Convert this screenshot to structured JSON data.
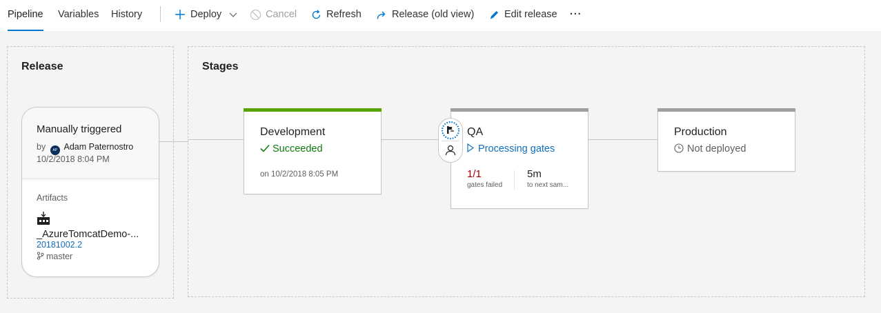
{
  "toolbar": {
    "tabs": [
      {
        "label": "Pipeline",
        "active": true
      },
      {
        "label": "Variables",
        "active": false
      },
      {
        "label": "History",
        "active": false
      }
    ],
    "actions": {
      "deploy": "Deploy",
      "cancel": "Cancel",
      "refresh": "Refresh",
      "release_old_view": "Release (old view)",
      "edit_release": "Edit release",
      "more": "···"
    }
  },
  "release_section": {
    "title": "Release",
    "trigger": "Manually triggered",
    "by_label": "by",
    "user_initials": "AP",
    "user_name": "Adam Paternostro",
    "datetime": "10/2/2018 8:04 PM",
    "artifacts_label": "Artifacts",
    "artifact_name": "_AzureTomcatDemo-...",
    "artifact_version": "20181002.2",
    "artifact_branch": "master"
  },
  "stages_section": {
    "title": "Stages",
    "stages": [
      {
        "name": "Development",
        "status": "Succeeded",
        "detail": "on 10/2/2018 8:05 PM",
        "bar_color": "#57a300",
        "status_color": "#107c10"
      },
      {
        "name": "QA",
        "status": "Processing gates",
        "gates_value": "1/1",
        "gates_label": "gates failed",
        "next_value": "5m",
        "next_label": "to next sam...",
        "bar_color": "#a19f9d",
        "status_color": "#106ebe"
      },
      {
        "name": "Production",
        "status": "Not deployed",
        "bar_color": "#a19f9d",
        "status_color": "#605e5c"
      }
    ]
  },
  "colors": {
    "accent": "#0078d4",
    "success": "#107c10",
    "link": "#106ebe",
    "error": "#a80000"
  }
}
